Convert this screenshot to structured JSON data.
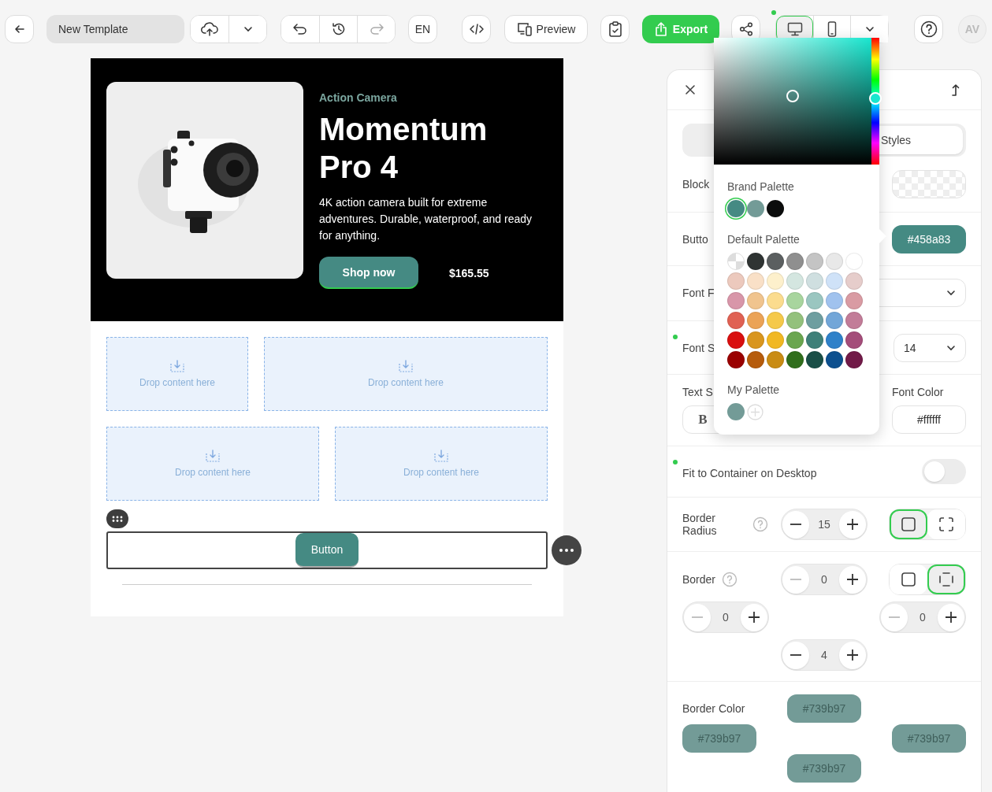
{
  "toolbar": {
    "template_name": "New Template",
    "language": "EN",
    "preview": "Preview",
    "export": "Export",
    "history": [
      {
        "kind": "undo",
        "disabled": false
      },
      {
        "kind": "history",
        "disabled": false
      },
      {
        "kind": "redo",
        "disabled": true
      }
    ],
    "devices_modified": true,
    "devices": [
      {
        "kind": "desktop",
        "selected": true
      },
      {
        "kind": "mobile",
        "selected": false
      }
    ],
    "avatar": "AV"
  },
  "email": {
    "hero": {
      "eyebrow": "Action Camera",
      "title": "Momentum Pro 4",
      "description": "4K action camera built for extreme adventures. Durable, waterproof, and ready for anything.",
      "button": "Shop now",
      "price": "$165.55"
    },
    "drop_rows": [
      {
        "zones": [
          "Drop content here",
          "Drop content here"
        ]
      },
      {
        "zones": [
          "Drop content here",
          "Drop content here"
        ]
      }
    ],
    "button_block": {
      "label": "Button",
      "selected": true
    }
  },
  "color_picker": {
    "hue": {
      "level": 0.48
    },
    "saturation": {
      "level": 0.5
    },
    "brightness": {
      "level": 0.54
    },
    "brand_title": "Brand Palette",
    "brand": [
      {
        "color": "#458a83",
        "selected": true
      },
      {
        "color": "#739b97",
        "selected": false
      },
      {
        "color": "#0b0c0c",
        "selected": false
      }
    ],
    "default_title": "Default Palette",
    "default": [
      [
        {
          "kind": "transparent"
        },
        {
          "kind": "color",
          "color": "#2f3433"
        },
        {
          "kind": "color",
          "color": "#5b5f60"
        },
        {
          "kind": "color",
          "color": "#8f8f8f"
        },
        {
          "kind": "color",
          "color": "#c4c4c4"
        },
        {
          "kind": "color",
          "color": "#e8e8e8"
        },
        {
          "kind": "color",
          "color": "#ffffff"
        }
      ],
      [
        {
          "kind": "color",
          "color": "#ecc9bd"
        },
        {
          "kind": "color",
          "color": "#f9e0c7"
        },
        {
          "kind": "color",
          "color": "#fdf0cc"
        },
        {
          "kind": "color",
          "color": "#d4e6e0"
        },
        {
          "kind": "color",
          "color": "#cfdfe0"
        },
        {
          "kind": "color",
          "color": "#cfe2f8"
        },
        {
          "kind": "color",
          "color": "#e6cdcb"
        }
      ],
      [
        {
          "kind": "color",
          "color": "#d896a9"
        },
        {
          "kind": "color",
          "color": "#f0c48e"
        },
        {
          "kind": "color",
          "color": "#fbdc8e"
        },
        {
          "kind": "color",
          "color": "#a8d59e"
        },
        {
          "kind": "color",
          "color": "#9ac6c0"
        },
        {
          "kind": "color",
          "color": "#a0c2ee"
        },
        {
          "kind": "color",
          "color": "#d99ba3"
        }
      ],
      [
        {
          "kind": "color",
          "color": "#e06153"
        },
        {
          "kind": "color",
          "color": "#eba356"
        },
        {
          "kind": "color",
          "color": "#f5c94a"
        },
        {
          "kind": "color",
          "color": "#93c17c"
        },
        {
          "kind": "color",
          "color": "#6e9ea0"
        },
        {
          "kind": "color",
          "color": "#72a6d8"
        },
        {
          "kind": "color",
          "color": "#c27c98"
        }
      ],
      [
        {
          "kind": "color",
          "color": "#d90f0f"
        },
        {
          "kind": "color",
          "color": "#d9961e"
        },
        {
          "kind": "color",
          "color": "#f1b822"
        },
        {
          "kind": "color",
          "color": "#6aa64f"
        },
        {
          "kind": "color",
          "color": "#3f8079"
        },
        {
          "kind": "color",
          "color": "#2f81c9"
        },
        {
          "kind": "color",
          "color": "#a44d7a"
        }
      ],
      [
        {
          "kind": "color",
          "color": "#9a0000"
        },
        {
          "kind": "color",
          "color": "#b65c0c"
        },
        {
          "kind": "color",
          "color": "#c98c14"
        },
        {
          "kind": "color",
          "color": "#306e1c"
        },
        {
          "kind": "color",
          "color": "#1a4f47"
        },
        {
          "kind": "color",
          "color": "#0d508f"
        },
        {
          "kind": "color",
          "color": "#711a48"
        }
      ]
    ],
    "mine_title": "My Palette",
    "mine": [
      {
        "color": "#739b97"
      }
    ]
  },
  "panel": {
    "tabs": [
      {
        "label": "Styles",
        "selected": true
      }
    ],
    "block_label": "Block",
    "button_label": "Butto",
    "button_color": "#458a83",
    "font_family_label": "Font F",
    "font_size": {
      "label": "Font S",
      "value": "14",
      "modified": true
    },
    "text_style_label": "Text S",
    "bold": "B",
    "font_color": {
      "label": "Font Color",
      "value": "#ffffff"
    },
    "fit": {
      "label": "Fit to Container on Desktop",
      "on": false,
      "modified": true
    },
    "border_radius": {
      "label": "Border Radius",
      "value": "15",
      "decrement_disabled": false,
      "modes": [
        {
          "kind": "uniform",
          "selected": true
        },
        {
          "kind": "individual",
          "selected": false
        }
      ]
    },
    "border": {
      "label": "Border",
      "modes": [
        {
          "kind": "uniform",
          "selected": false
        },
        {
          "kind": "individual",
          "selected": true
        }
      ],
      "sides": {
        "top": {
          "value": "0",
          "decrement_disabled": true
        },
        "left": {
          "value": "0",
          "decrement_disabled": true
        },
        "right": {
          "value": "0",
          "decrement_disabled": true
        },
        "bottom": {
          "value": "4",
          "decrement_disabled": false
        }
      }
    },
    "border_color": {
      "label": "Border Color",
      "top": "#739b97",
      "left": "#739b97",
      "right": "#739b97",
      "bottom": "#739b97"
    }
  }
}
